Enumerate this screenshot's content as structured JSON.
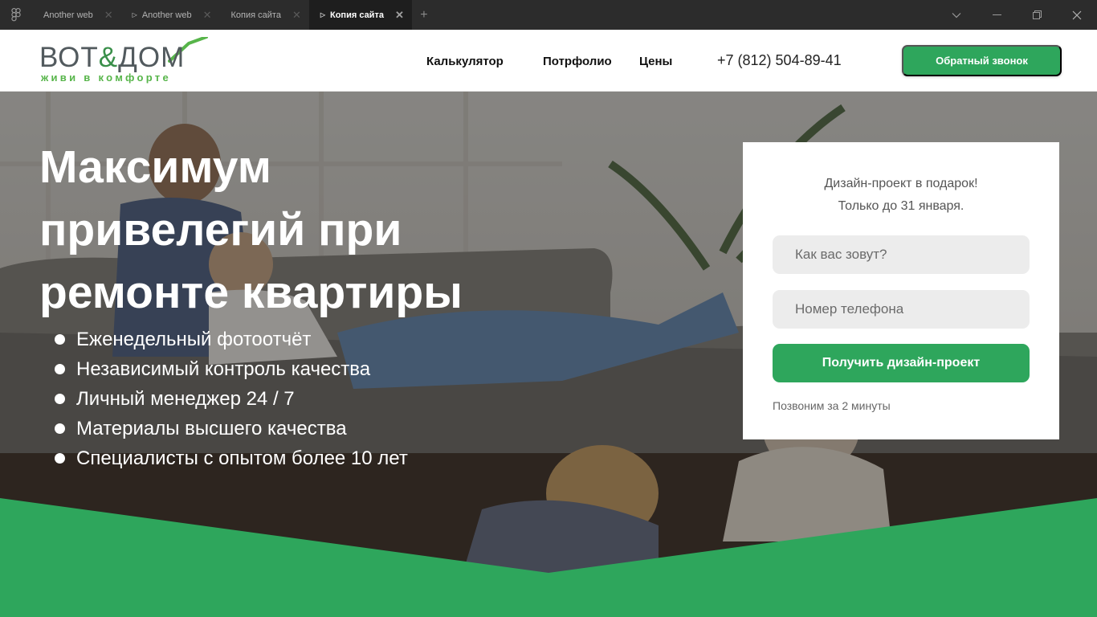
{
  "browser": {
    "tabs": [
      {
        "label": "Another web",
        "active": false,
        "play": false
      },
      {
        "label": "Another web",
        "active": false,
        "play": true
      },
      {
        "label": "Копия сайта",
        "active": false,
        "play": false
      },
      {
        "label": "Копия сайта",
        "active": true,
        "play": true
      }
    ]
  },
  "site": {
    "logo": {
      "brand_left": "ВОТ",
      "brand_amp": "&",
      "brand_right": "ДОМ",
      "tagline": "живи в комфорте"
    },
    "nav": [
      "Калькулятор",
      "Потрфолио",
      "Цены"
    ],
    "phone": "+7 (812) 504-89-41",
    "callback_label": "Обратный звонок"
  },
  "hero": {
    "title_lines": [
      "Максимум",
      "привелегий при",
      "ремонте квартиры"
    ],
    "features": [
      "Еженедельный фотоотчёт",
      "Независимый контроль качества",
      "Личный менеджер 24 / 7",
      "Материалы высшего качества",
      "Специалисты с опытом более  10 лет"
    ]
  },
  "form": {
    "promo_line1": "Дизайн-проект в подарок!",
    "promo_line2": "Только до 31 января.",
    "name_placeholder": "Как вас зовут?",
    "phone_placeholder": "Номер телефона",
    "submit_label": "Получить дизайн-проект",
    "note": "Позвоним за 2 минуты"
  },
  "colors": {
    "accent": "#2ea65c",
    "logo_text": "#525a5e",
    "tagline": "#57b54a"
  }
}
